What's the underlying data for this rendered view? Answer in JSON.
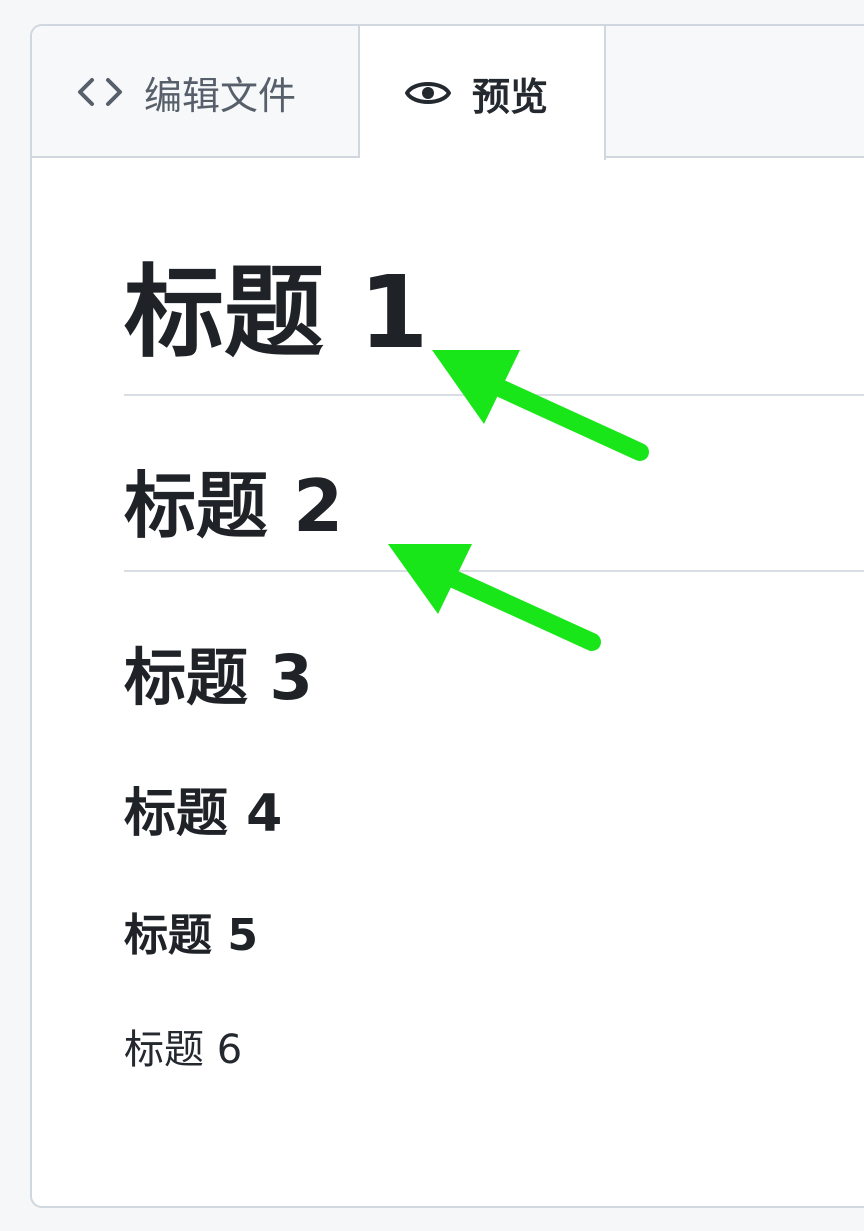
{
  "tabs": {
    "edit": {
      "icon": "code-icon",
      "label": "编辑文件"
    },
    "preview": {
      "icon": "eye-icon",
      "label": "预览",
      "active": true
    }
  },
  "headings": {
    "h1": "标题 1",
    "h2": "标题 2",
    "h3": "标题 3",
    "h4": "标题 4",
    "h5": "标题 5",
    "h6": "标题 6"
  },
  "annotations": {
    "arrow_color": "#19e619"
  },
  "colors": {
    "border": "#d0d7de",
    "tabbar_bg": "#f6f8fa",
    "text": "#1f2328"
  }
}
